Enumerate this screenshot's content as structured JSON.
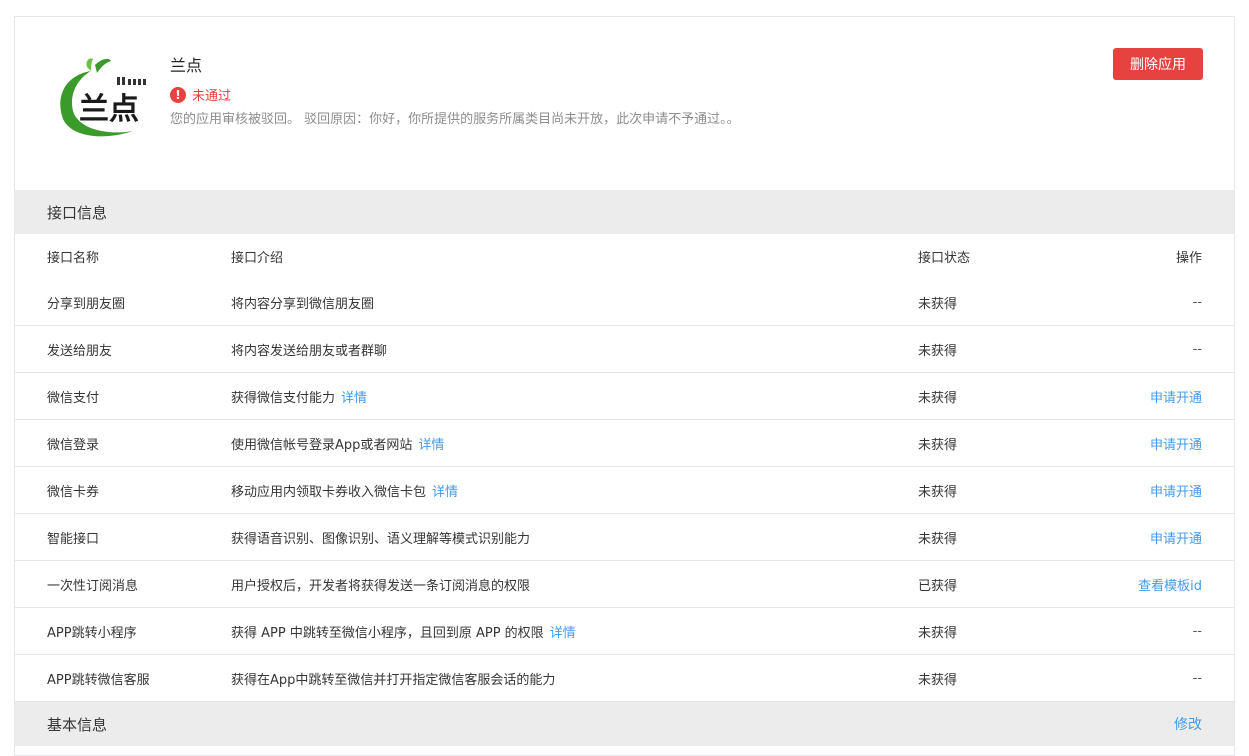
{
  "app": {
    "name": "兰点",
    "logo_text": "兰点",
    "status": "未通过",
    "reason": "您的应用审核被驳回。 驳回原因：你好，你所提供的服务所属类目尚未开放，此次申请不予通过。。",
    "delete_label": "删除应用"
  },
  "api_section": {
    "title": "接口信息",
    "headers": {
      "name": "接口名称",
      "desc": "接口介绍",
      "status": "接口状态",
      "op": "操作"
    },
    "rows": [
      {
        "name": "分享到朋友圈",
        "desc": "将内容分享到微信朋友圈",
        "detail": "",
        "status": "未获得",
        "op": "--"
      },
      {
        "name": "发送给朋友",
        "desc": "将内容发送给朋友或者群聊",
        "detail": "",
        "status": "未获得",
        "op": "--"
      },
      {
        "name": "微信支付",
        "desc": "获得微信支付能力",
        "detail": "详情",
        "status": "未获得",
        "op": "申请开通"
      },
      {
        "name": "微信登录",
        "desc": "使用微信帐号登录App或者网站",
        "detail": "详情",
        "status": "未获得",
        "op": "申请开通"
      },
      {
        "name": "微信卡券",
        "desc": "移动应用内领取卡券收入微信卡包",
        "detail": "详情",
        "status": "未获得",
        "op": "申请开通"
      },
      {
        "name": "智能接口",
        "desc": "获得语音识别、图像识别、语义理解等模式识别能力",
        "detail": "",
        "status": "未获得",
        "op": "申请开通"
      },
      {
        "name": "一次性订阅消息",
        "desc": "用户授权后，开发者将获得发送一条订阅消息的权限",
        "detail": "",
        "status": "已获得",
        "op": "查看模板id"
      },
      {
        "name": "APP跳转小程序",
        "desc": "获得 APP 中跳转至微信小程序，且回到原 APP 的权限",
        "detail": "详情",
        "status": "未获得",
        "op": "--"
      },
      {
        "name": "APP跳转微信客服",
        "desc": "获得在App中跳转至微信并打开指定微信客服会话的能力",
        "detail": "",
        "status": "未获得",
        "op": "--"
      }
    ]
  },
  "basic_section": {
    "title": "基本信息",
    "edit_label": "修改"
  },
  "colors": {
    "accent": "#459ae9",
    "danger": "#e64340",
    "logo_green": "#3a9b2a"
  }
}
